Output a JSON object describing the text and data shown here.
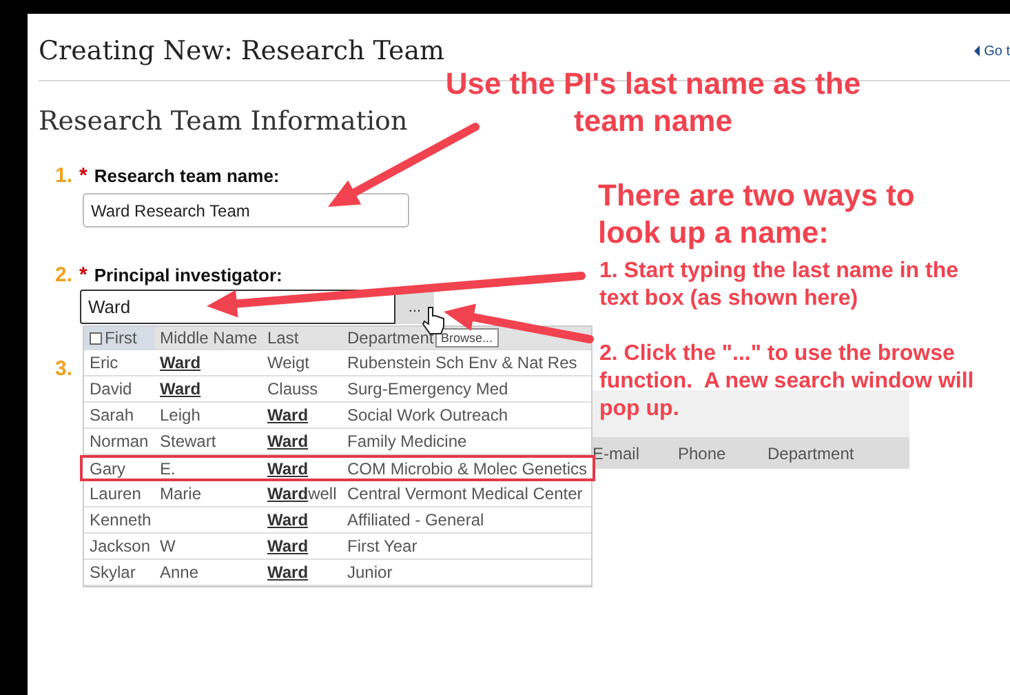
{
  "page": {
    "title": "Creating New: Research Team",
    "back_link": "Go t"
  },
  "section_title": "Research Team Information",
  "fields": [
    {
      "number": "1.",
      "required_mark": "*",
      "label": "Research team name:",
      "value": "Ward Research Team"
    },
    {
      "number": "2.",
      "required_mark": "*",
      "label": "Principal investigator:",
      "value": "Ward",
      "browse_button": "...",
      "tooltip": "Browse..."
    }
  ],
  "field_3": {
    "number": "3."
  },
  "lookup": {
    "columns": [
      "First",
      "Middle Name",
      "Last",
      "Department"
    ],
    "rows": [
      {
        "first": "Eric",
        "middle": "**Ward**",
        "last": "Weigt",
        "department": "Rubenstein Sch Env & Nat Res",
        "highlighted": false
      },
      {
        "first": "David",
        "middle": "**Ward**",
        "last": "Clauss",
        "department": "Surg-Emergency Med",
        "highlighted": false
      },
      {
        "first": "Sarah",
        "middle": "Leigh",
        "last": "**Ward**",
        "department": "Social Work Outreach",
        "highlighted": false
      },
      {
        "first": "Norman",
        "middle": "Stewart",
        "last": "**Ward**",
        "department": "Family Medicine",
        "highlighted": false
      },
      {
        "first": "Gary",
        "middle": "E.",
        "last": "**Ward**",
        "department": "COM Microbio & Molec Genetics",
        "highlighted": true
      },
      {
        "first": "Lauren",
        "middle": "Marie",
        "last": "**Ward**well",
        "department": "Central Vermont Medical Center",
        "highlighted": false
      },
      {
        "first": "Kenneth",
        "middle": "",
        "last": "**Ward**",
        "department": "Affiliated - General",
        "highlighted": false
      },
      {
        "first": "Jackson",
        "middle": "W",
        "last": "**Ward**",
        "department": "First Year",
        "highlighted": false
      },
      {
        "first": "Skylar",
        "middle": "Anne",
        "last": "**Ward**",
        "department": "Junior",
        "highlighted": false
      }
    ]
  },
  "members_table": {
    "columns": [
      "E-mail",
      "Phone",
      "Department"
    ]
  },
  "annotations": [
    {
      "kind": "heading",
      "text": "Use the PI's last name as the team name"
    },
    {
      "kind": "heading",
      "text": "There are two ways to look up a name:"
    },
    {
      "kind": "step",
      "text": "1. Start typing the last name in the text box (as shown here)"
    },
    {
      "kind": "step",
      "text": "2. Click the \"...\" to use the browse function.  A new search window will pop up."
    }
  ]
}
